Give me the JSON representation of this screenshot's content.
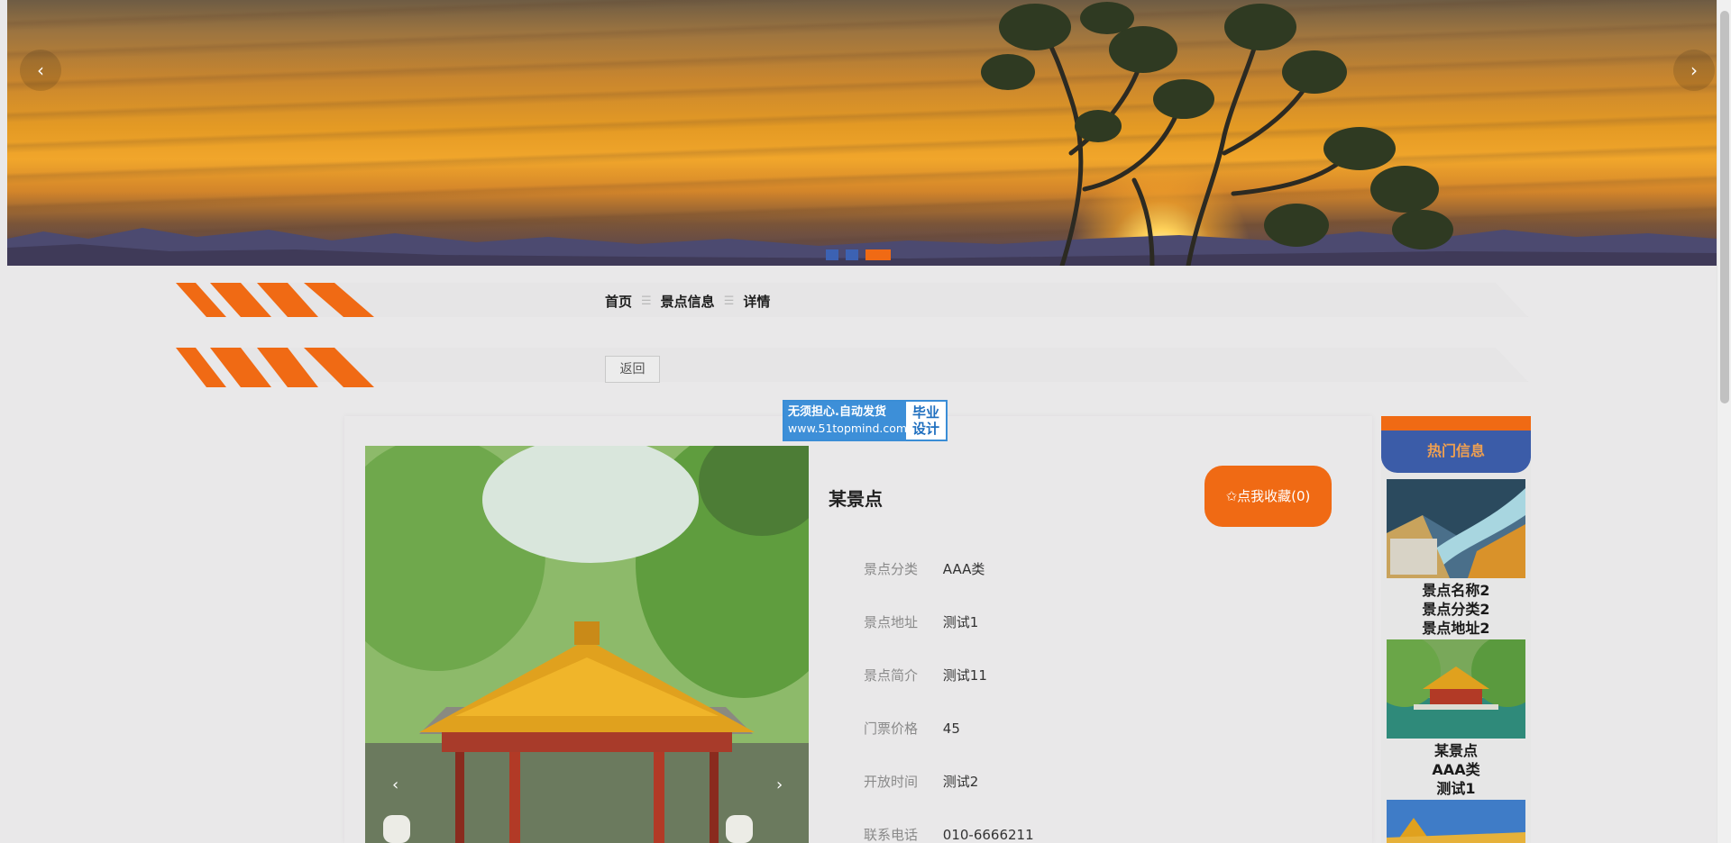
{
  "banner": {
    "prev_label": "‹",
    "next_label": "›",
    "slides": 3,
    "active_slide": 3
  },
  "breadcrumb": {
    "home": "首页",
    "separator": "☰",
    "section": "景点信息",
    "current": "详情"
  },
  "back_button": "返回",
  "watermark": {
    "line1": "无须担心.自动发货",
    "url": "www.51topmind.com",
    "right1": "毕业",
    "right2": "设计"
  },
  "detail": {
    "title": "某景点",
    "favorite_label": "✩点我收藏(0)",
    "gallery_prev": "‹",
    "gallery_next": "›",
    "fields": [
      {
        "label": "景点分类",
        "value": "AAA类"
      },
      {
        "label": "景点地址",
        "value": "测试1"
      },
      {
        "label": "景点简介",
        "value": "测试11"
      },
      {
        "label": "门票价格",
        "value": "45"
      },
      {
        "label": "开放时间",
        "value": "测试2"
      },
      {
        "label": "联系电话",
        "value": "010-6666211"
      }
    ]
  },
  "hot": {
    "title": "热门信息",
    "items": [
      {
        "line1": "景点名称2",
        "line2": "景点分类2",
        "line3": "景点地址2"
      },
      {
        "line1": "某景点",
        "line2": "AAA类",
        "line3": "测试1"
      }
    ]
  },
  "colors": {
    "accent": "#f06a14",
    "blue": "#3b5ca8",
    "background": "#e9e8e9"
  }
}
